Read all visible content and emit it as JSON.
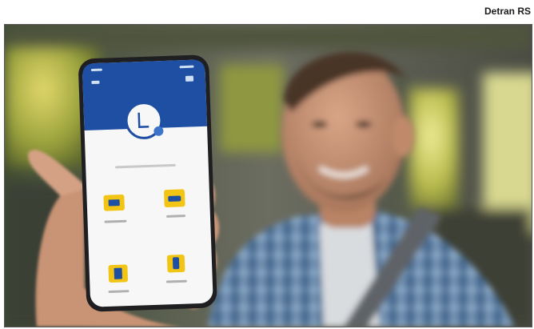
{
  "credit": {
    "text": "Detran RS"
  },
  "photo": {
    "subject": "man-in-car-holding-phone",
    "phone_app": {
      "status_time": "",
      "header_color": "#1e4fa3",
      "icon_color": "#f2c515",
      "icons": [
        "license-card-icon",
        "car-icon",
        "document-icon",
        "phone-alert-icon"
      ]
    }
  }
}
